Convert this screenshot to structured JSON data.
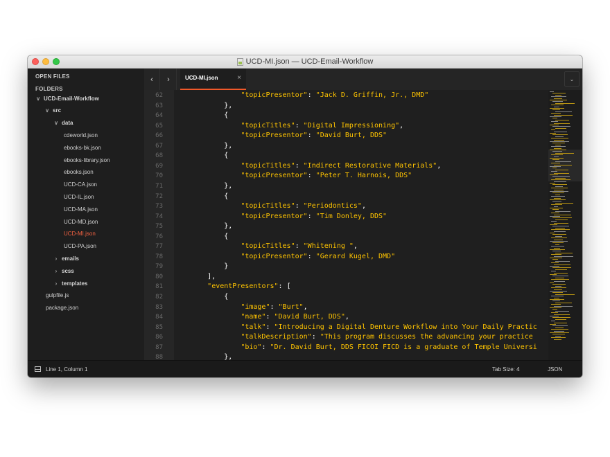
{
  "window": {
    "title": "UCD-MI.json — UCD-Email-Workflow"
  },
  "sidebar": {
    "open_files_label": "OPEN FILES",
    "folders_label": "FOLDERS",
    "tree": [
      {
        "label": "UCD-Email-Workflow",
        "type": "folder",
        "expanded": true,
        "depth": 0
      },
      {
        "label": "src",
        "type": "folder",
        "expanded": true,
        "depth": 1
      },
      {
        "label": "data",
        "type": "folder",
        "expanded": true,
        "depth": 2
      },
      {
        "label": "cdeworld.json",
        "type": "file",
        "depth": 3
      },
      {
        "label": "ebooks-bk.json",
        "type": "file",
        "depth": 3
      },
      {
        "label": "ebooks-library.json",
        "type": "file",
        "depth": 3
      },
      {
        "label": "ebooks.json",
        "type": "file",
        "depth": 3
      },
      {
        "label": "UCD-CA.json",
        "type": "file",
        "depth": 3
      },
      {
        "label": "UCD-IL.json",
        "type": "file",
        "depth": 3
      },
      {
        "label": "UCD-MA.json",
        "type": "file",
        "depth": 3
      },
      {
        "label": "UCD-MD.json",
        "type": "file",
        "depth": 3
      },
      {
        "label": "UCD-MI.json",
        "type": "file",
        "depth": 3,
        "active": true
      },
      {
        "label": "UCD-PA.json",
        "type": "file",
        "depth": 3
      },
      {
        "label": "emails",
        "type": "folder",
        "expanded": false,
        "depth": 2
      },
      {
        "label": "scss",
        "type": "folder",
        "expanded": false,
        "depth": 2
      },
      {
        "label": "templates",
        "type": "folder",
        "expanded": false,
        "depth": 2
      },
      {
        "label": "gulpfile.js",
        "type": "file",
        "depth": 1
      },
      {
        "label": "package.json",
        "type": "file",
        "depth": 1
      }
    ]
  },
  "tabs": {
    "back_icon": "chevron-left",
    "forward_icon": "chevron-right",
    "items": [
      {
        "label": "UCD-MI.json",
        "active": true
      }
    ],
    "close_glyph": "×",
    "dropdown_icon": "chevron-down"
  },
  "editor": {
    "lines": [
      {
        "n": "62",
        "tokens": [
          [
            "i",
            "                "
          ],
          [
            "s",
            "\"topicPresentor\""
          ],
          [
            "p",
            ": "
          ],
          [
            "s",
            "\"Jack D. Griffin, Jr., DMD\""
          ]
        ]
      },
      {
        "n": "63",
        "tokens": [
          [
            "i",
            "            "
          ],
          [
            "p",
            "},"
          ]
        ]
      },
      {
        "n": "64",
        "tokens": [
          [
            "i",
            "            "
          ],
          [
            "p",
            "{"
          ]
        ]
      },
      {
        "n": "65",
        "tokens": [
          [
            "i",
            "                "
          ],
          [
            "s",
            "\"topicTitles\""
          ],
          [
            "p",
            ": "
          ],
          [
            "s",
            "\"Digital Impressioning\""
          ],
          [
            "p",
            ","
          ]
        ]
      },
      {
        "n": "66",
        "tokens": [
          [
            "i",
            "                "
          ],
          [
            "s",
            "\"topicPresentor\""
          ],
          [
            "p",
            ": "
          ],
          [
            "s",
            "\"David Burt, DDS\""
          ]
        ]
      },
      {
        "n": "67",
        "tokens": [
          [
            "i",
            "            "
          ],
          [
            "p",
            "},"
          ]
        ]
      },
      {
        "n": "68",
        "tokens": [
          [
            "i",
            "            "
          ],
          [
            "p",
            "{"
          ]
        ]
      },
      {
        "n": "69",
        "tokens": [
          [
            "i",
            "                "
          ],
          [
            "s",
            "\"topicTitles\""
          ],
          [
            "p",
            ": "
          ],
          [
            "s",
            "\"Indirect Restorative Materials\""
          ],
          [
            "p",
            ","
          ]
        ]
      },
      {
        "n": "70",
        "tokens": [
          [
            "i",
            "                "
          ],
          [
            "s",
            "\"topicPresentor\""
          ],
          [
            "p",
            ": "
          ],
          [
            "s",
            "\"Peter T. Harnois, DDS\""
          ]
        ]
      },
      {
        "n": "71",
        "tokens": [
          [
            "i",
            "            "
          ],
          [
            "p",
            "},"
          ]
        ]
      },
      {
        "n": "72",
        "tokens": [
          [
            "i",
            "            "
          ],
          [
            "p",
            "{"
          ]
        ]
      },
      {
        "n": "73",
        "tokens": [
          [
            "i",
            "                "
          ],
          [
            "s",
            "\"topicTitles\""
          ],
          [
            "p",
            ": "
          ],
          [
            "s",
            "\"Periodontics\""
          ],
          [
            "p",
            ","
          ]
        ]
      },
      {
        "n": "74",
        "tokens": [
          [
            "i",
            "                "
          ],
          [
            "s",
            "\"topicPresentor\""
          ],
          [
            "p",
            ": "
          ],
          [
            "s",
            "\"Tim Donley, DDS\""
          ]
        ]
      },
      {
        "n": "75",
        "tokens": [
          [
            "i",
            "            "
          ],
          [
            "p",
            "},"
          ]
        ]
      },
      {
        "n": "76",
        "tokens": [
          [
            "i",
            "            "
          ],
          [
            "p",
            "{"
          ]
        ]
      },
      {
        "n": "77",
        "tokens": [
          [
            "i",
            "                "
          ],
          [
            "s",
            "\"topicTitles\""
          ],
          [
            "p",
            ": "
          ],
          [
            "s",
            "\"Whitening \""
          ],
          [
            "p",
            ","
          ]
        ]
      },
      {
        "n": "78",
        "tokens": [
          [
            "i",
            "                "
          ],
          [
            "s",
            "\"topicPresentor\""
          ],
          [
            "p",
            ": "
          ],
          [
            "s",
            "\"Gerard Kugel, DMD\""
          ]
        ]
      },
      {
        "n": "79",
        "tokens": [
          [
            "i",
            "            "
          ],
          [
            "p",
            "}"
          ]
        ]
      },
      {
        "n": "80",
        "tokens": [
          [
            "i",
            "        "
          ],
          [
            "p",
            "],"
          ]
        ]
      },
      {
        "n": "81",
        "tokens": [
          [
            "i",
            "        "
          ],
          [
            "s",
            "\"eventPresentors\""
          ],
          [
            "p",
            ": ["
          ]
        ]
      },
      {
        "n": "82",
        "tokens": [
          [
            "i",
            "            "
          ],
          [
            "p",
            "{"
          ]
        ]
      },
      {
        "n": "83",
        "tokens": [
          [
            "i",
            "                "
          ],
          [
            "s",
            "\"image\""
          ],
          [
            "p",
            ": "
          ],
          [
            "s",
            "\"Burt\""
          ],
          [
            "p",
            ","
          ]
        ]
      },
      {
        "n": "84",
        "tokens": [
          [
            "i",
            "                "
          ],
          [
            "s",
            "\"name\""
          ],
          [
            "p",
            ": "
          ],
          [
            "s",
            "\"David Burt, DDS\""
          ],
          [
            "p",
            ","
          ]
        ]
      },
      {
        "n": "85",
        "tokens": [
          [
            "i",
            "                "
          ],
          [
            "s",
            "\"talk\""
          ],
          [
            "p",
            ": "
          ],
          [
            "s",
            "\"Introducing a Digital Denture Workflow into Your Daily Practic"
          ]
        ]
      },
      {
        "n": "86",
        "tokens": [
          [
            "i",
            "                "
          ],
          [
            "s",
            "\"talkDescription\""
          ],
          [
            "p",
            ": "
          ],
          [
            "s",
            "\"This program discusses the advancing your practice"
          ]
        ]
      },
      {
        "n": "87",
        "tokens": [
          [
            "i",
            "                "
          ],
          [
            "s",
            "\"bio\""
          ],
          [
            "p",
            ": "
          ],
          [
            "s",
            "\"Dr. David Burt, DDS FICOI FICD is a graduate of Temple Universi"
          ]
        ]
      },
      {
        "n": "88",
        "tokens": [
          [
            "i",
            "            "
          ],
          [
            "p",
            "},"
          ]
        ]
      }
    ]
  },
  "status": {
    "position": "Line 1, Column 1",
    "tab_size": "Tab Size: 4",
    "syntax": "JSON"
  },
  "colors": {
    "accent": "#f1592a",
    "string": "#ffc400",
    "background": "#1e1e1e"
  }
}
